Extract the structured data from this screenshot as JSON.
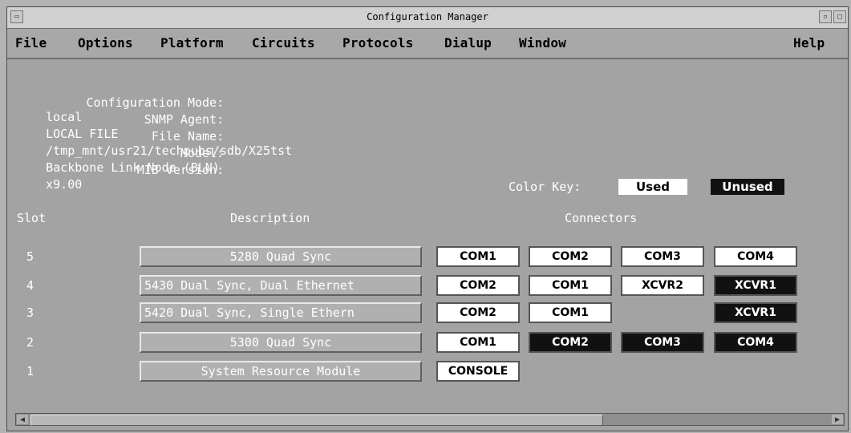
{
  "window": {
    "title": "Configuration Manager"
  },
  "menu": {
    "file": "File",
    "options": "Options",
    "platform": "Platform",
    "circuits": "Circuits",
    "protocols": "Protocols",
    "dialup": "Dialup",
    "window": "Window",
    "help": "Help"
  },
  "info": {
    "mode_label": "Configuration Mode:",
    "mode_value": "local",
    "agent_label": "SNMP Agent:",
    "agent_value": "LOCAL FILE",
    "file_label": "File Name:",
    "file_value": "/tmp_mnt/usr21/techpubs/sdb/X25tst",
    "model_label": "Model:",
    "model_value": "Backbone Link Node (BLN)",
    "mib_label": "MIB Version:",
    "mib_value": "x9.00"
  },
  "color_key": {
    "label": "Color Key:",
    "used": "Used",
    "unused": "Unused",
    "used_color": "#ffffff",
    "unused_color": "#111111"
  },
  "headers": {
    "slot": "Slot",
    "description": "Description",
    "connectors": "Connectors"
  },
  "slots": [
    {
      "slot": "5",
      "description": "5280  Quad Sync",
      "connectors": [
        {
          "label": "COM1",
          "state": "used"
        },
        {
          "label": "COM2",
          "state": "used"
        },
        {
          "label": "COM3",
          "state": "used"
        },
        {
          "label": "COM4",
          "state": "used"
        }
      ]
    },
    {
      "slot": "4",
      "description": "5430  Dual Sync, Dual Ethernet",
      "connectors": [
        {
          "label": "COM2",
          "state": "used"
        },
        {
          "label": "COM1",
          "state": "used"
        },
        {
          "label": "XCVR2",
          "state": "used"
        },
        {
          "label": "XCVR1",
          "state": "unused"
        }
      ]
    },
    {
      "slot": "3",
      "description": "5420  Dual Sync, Single Ethern",
      "connectors": [
        {
          "label": "COM2",
          "state": "used"
        },
        {
          "label": "COM1",
          "state": "used"
        },
        null,
        {
          "label": "XCVR1",
          "state": "unused"
        }
      ]
    },
    {
      "slot": "2",
      "description": "5300  Quad Sync",
      "connectors": [
        {
          "label": "COM1",
          "state": "used"
        },
        {
          "label": "COM2",
          "state": "unused"
        },
        {
          "label": "COM3",
          "state": "unused"
        },
        {
          "label": "COM4",
          "state": "unused"
        }
      ]
    },
    {
      "slot": "1",
      "description": "System Resource Module",
      "connectors": [
        {
          "label": "CONSOLE",
          "state": "used"
        }
      ]
    }
  ]
}
